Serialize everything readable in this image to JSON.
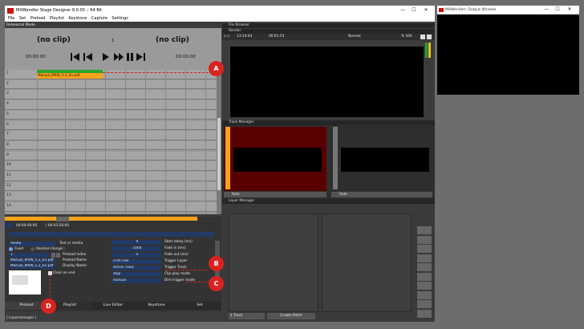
{
  "main_window": {
    "title": "MXWendler Stage Designer 6.0.00 :: 64 Bit",
    "menu": [
      "File",
      "Set",
      "Preload",
      "Playlist",
      "Keystone",
      "Capture",
      "Settings"
    ],
    "controls": {
      "minimize": "—",
      "maximize": "☐",
      "close": "✕"
    }
  },
  "rehearsal": {
    "label": "Rehearsal Mode",
    "left_clip": "(no clip)",
    "right_clip": "(no clip)",
    "counter": "1",
    "left_tc": "00:00:00",
    "right_tc": "00:00:00",
    "clip_name": "Manual_MXW_5.2_En.pdf",
    "track_numbers": [
      "1",
      "2",
      "3",
      "4",
      "5",
      "6",
      "7",
      "8",
      "9",
      "10",
      "11",
      "12",
      "13",
      "14"
    ]
  },
  "settings": {
    "tc_start": "00:00:00:00",
    "tc_end": "/ 00:03:56:00",
    "media": "media",
    "text_or_media": "Text or media",
    "fixed": "Fixed",
    "random_range": "Random Range",
    "random_range_value": "(?)",
    "preload_index_value": "1",
    "preload_index": "Preload Index",
    "preload_name_value": "Manual_MXW_5.2_En.pdf",
    "preload_name": "Preload Name",
    "display_name_value": "Manual_MXW_5.2_En.pdf",
    "display_name": "Display Name",
    "clear_on_end": "Clear on end",
    "start_delay_value": "0",
    "start_delay": "Start delay (ms)",
    "fade_in_value": "1000",
    "fade_in": "Fade in (ms)",
    "fade_out_value": "0",
    "fade_out": "Fade out (ms)",
    "trigger_layer_value": "First Free",
    "trigger_layer": "Trigger Layer",
    "trigger_track_value": "Active Track",
    "trigger_track": "Trigger Track",
    "clip_play_mode_value": "stop",
    "clip_play_mode": "Clip play mode",
    "dim_trigger_mode_value": "manual",
    "dim_trigger_mode": "Dim trigger mode"
  },
  "tabs": [
    "Preload",
    "Playlist",
    "Live Editor",
    "Keystone",
    "Set"
  ],
  "status_bar": "[ Layermanager ]",
  "file_browser": {
    "label": "File Browser"
  },
  "render": {
    "label": "Render",
    "time": "13:14:44",
    "duration": "00:01:53",
    "mode": "Normal",
    "percent": "% 100"
  },
  "track_manager": {
    "label": "Track Manager",
    "fade_left": "fade",
    "fade_right": "fade"
  },
  "layer_manager": {
    "label": "Layer Manager",
    "track_button": "1 Track",
    "create_patch": "Create Patch"
  },
  "output_window": {
    "title": "MXWendler: Output Window"
  },
  "markers": [
    "A",
    "B",
    "C",
    "D"
  ],
  "colors": {
    "accent_red": "#d9231f",
    "track_active": "#5a0000",
    "orange": "#f7a21b",
    "field_blue": "#223a66"
  }
}
